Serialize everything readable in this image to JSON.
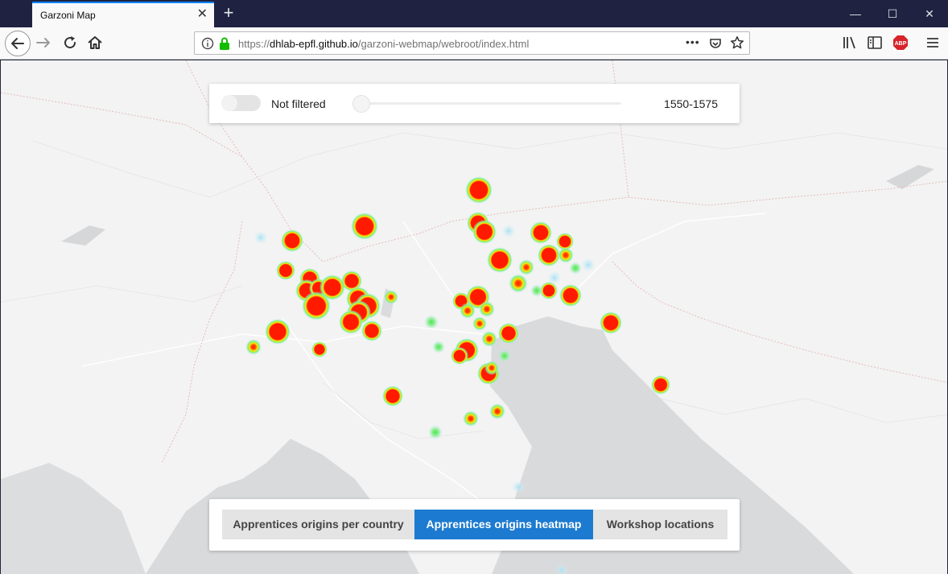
{
  "browser": {
    "tab_title": "Garzoni Map",
    "url_prefix": "https://",
    "url_host": "dhlab-epfl.github.io",
    "url_path": "/garzoni-webmap/webroot/index.html"
  },
  "filter": {
    "toggle_label": "Not filtered",
    "range_label": "1550-1575",
    "slider_value": 0,
    "toggle_on": false
  },
  "views": {
    "buttons": [
      "Apprentices origins per country",
      "Apprentices origins heatmap",
      "Workshop locations"
    ],
    "active": "Apprentices origins heatmap"
  },
  "icons": {
    "back": "arrow-left-icon",
    "forward": "arrow-right-icon",
    "reload": "reload-icon",
    "home": "home-icon",
    "info": "info-icon",
    "lock": "lock-icon",
    "more": "more-icon",
    "pocket": "pocket-icon",
    "bookmark": "star-icon",
    "library": "library-icon",
    "sidebar": "sidebar-icon",
    "adblock": "abp-icon",
    "menu": "hamburger-icon"
  },
  "colors": {
    "active_button": "#1c7bd0",
    "heat_hot": "#ff1a00",
    "heat_warm": "#ffe600",
    "heat_cool": "#7cf07c",
    "heat_cold": "#bde8f5",
    "water": "#d9dadc"
  }
}
